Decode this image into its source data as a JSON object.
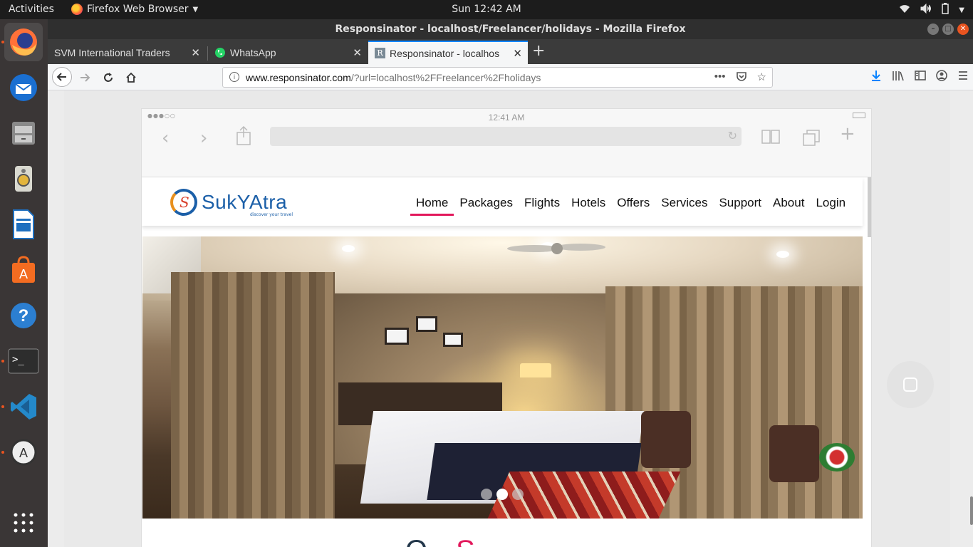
{
  "topbar": {
    "activities": "Activities",
    "app_menu": "Firefox Web Browser",
    "clock": "Sun 12:42 AM"
  },
  "window": {
    "title": "Responsinator - localhost/Freelancer/holidays - Mozilla Firefox"
  },
  "tabs": [
    {
      "label": "SVM International Traders",
      "active": false
    },
    {
      "label": "WhatsApp",
      "active": false
    },
    {
      "label": "Responsinator - localhos",
      "active": true
    }
  ],
  "urlbar": {
    "domain": "www.responsinator.com",
    "path": "/?url=localhost%2FFreelancer%2Fholidays"
  },
  "device": {
    "status_time": "12:41 AM"
  },
  "site": {
    "logo_text": "SukYAtra",
    "logo_tagline": "discover your travel",
    "menu": [
      "Home",
      "Packages",
      "Flights",
      "Hotels",
      "Offers",
      "Services",
      "Support",
      "About",
      "Login"
    ],
    "active_menu": "Home",
    "section_peek_a": "O",
    "section_peek_b": "S",
    "slider_active_index": 1,
    "slider_count": 3
  },
  "colors": {
    "accent": "#e2185b",
    "brand_blue": "#1b5fa8",
    "ubuntu_orange": "#e95420"
  }
}
